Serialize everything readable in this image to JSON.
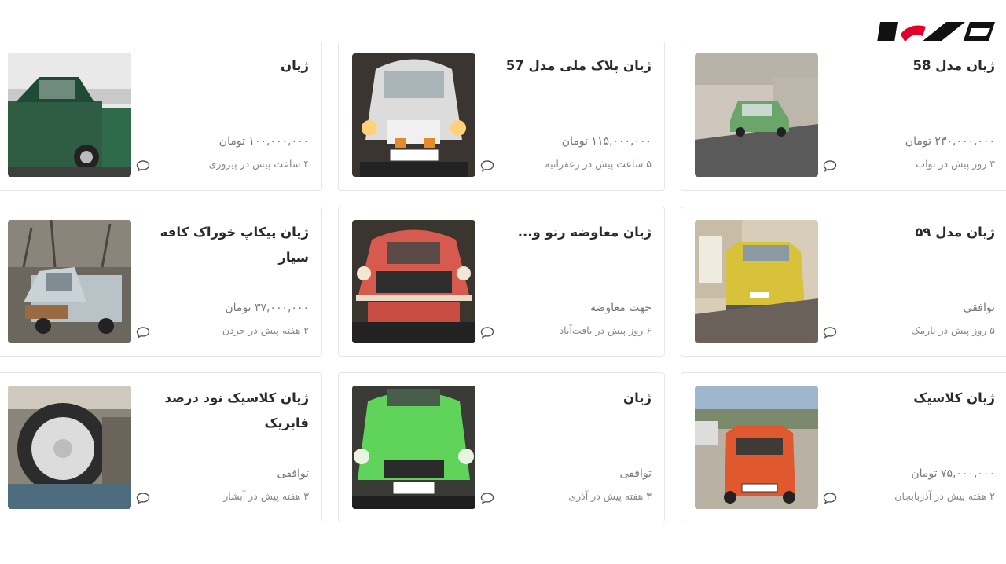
{
  "brand": {
    "logo_text": "رکنا",
    "logo_icon": "rokna-logo-icon"
  },
  "listings": [
    {
      "title": "ژیان",
      "price": "۱۰۰,۰۰۰,۰۰۰ تومان",
      "meta": "۴ ساعت پیش در پیروزی",
      "image": "green-citroen-street"
    },
    {
      "title": "ژیان پلاک ملی مدل 57",
      "price": "۱۱۵,۰۰۰,۰۰۰ تومان",
      "meta": "۵ ساعت پیش در زعفرانیه",
      "image": "white-citroen-front"
    },
    {
      "title": "ژیان مدل 58",
      "price": "۲۳۰,۰۰۰,۰۰۰ تومان",
      "meta": "۳ روز پیش در نواب",
      "image": "dark-green-citroen"
    },
    {
      "title": "ژیان مدل ۵۹",
      "price": "توافقی",
      "meta": "۵ روز پیش در نارمک",
      "image": "yellow-citroen-rear"
    },
    {
      "title": "ژیان معاوضه رنو و...",
      "price": "جهت معاوضه",
      "meta": "۶ روز پیش در یافت‌آباد",
      "image": "red-citroen-front"
    },
    {
      "title": "ژیان پیکاپ خوراک کافه سیار",
      "price": "۳۷,۰۰۰,۰۰۰ تومان",
      "meta": "۲ هفته پیش در جردن",
      "image": "rusty-pickup"
    },
    {
      "title": "ژیان کلاسیک",
      "price": "۷۵,۰۰۰,۰۰۰ تومان",
      "meta": "۲ هفته پیش در آذربایجان",
      "image": "orange-citroen-rear"
    },
    {
      "title": "ژیان",
      "price": "توافقی",
      "meta": "۳ هفته پیش در آذری",
      "image": "lime-citroen-front"
    },
    {
      "title": "ژیان کلاسیک نود درصد فابریک",
      "price": "توافقی",
      "meta": "۳ هفته پیش در آبشار",
      "image": "spare-tire-engine"
    }
  ],
  "colors": {
    "accent": "#e4002b",
    "text": "#2b2b2b",
    "muted": "#888888",
    "border": "#e6e6e6"
  }
}
